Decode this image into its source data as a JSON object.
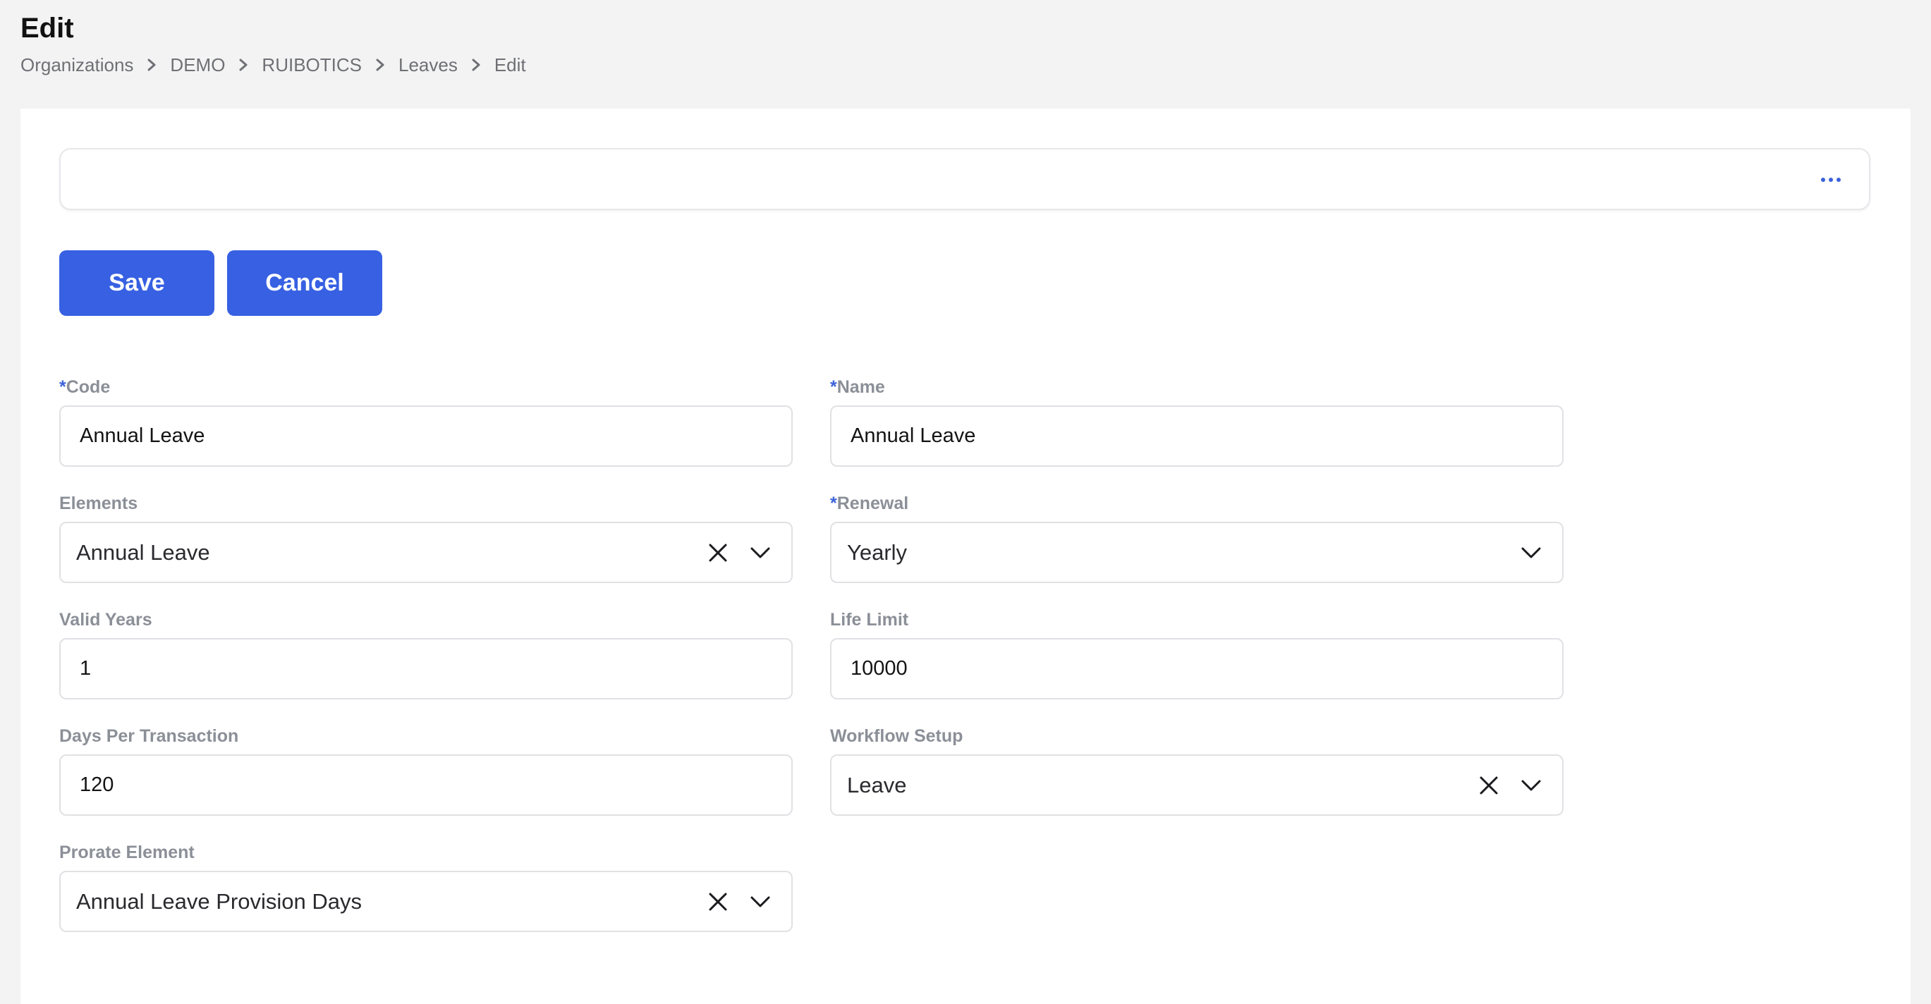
{
  "page": {
    "title": "Edit"
  },
  "breadcrumb": [
    "Organizations",
    "DEMO",
    "RUIBOTICS",
    "Leaves",
    "Edit"
  ],
  "toolbar": {
    "more_icon": "ellipsis-horizontal-icon",
    "save_label": "Save",
    "cancel_label": "Cancel"
  },
  "colors": {
    "primary": "#3760e2",
    "required_marker": "#3a62d9",
    "label": "#8b8f97",
    "page_background": "#f3f3f3"
  },
  "form": {
    "required_marker": "*",
    "code": {
      "label": "Code",
      "required": true,
      "value": "Annual Leave"
    },
    "name": {
      "label": "Name",
      "required": true,
      "value": "Annual Leave"
    },
    "elements": {
      "label": "Elements",
      "required": false,
      "value": "Annual Leave",
      "clearable": true
    },
    "renewal": {
      "label": "Renewal",
      "required": true,
      "value": "Yearly",
      "clearable": false
    },
    "valid_years": {
      "label": "Valid Years",
      "required": false,
      "value": "1"
    },
    "life_limit": {
      "label": "Life Limit",
      "required": false,
      "value": "10000"
    },
    "days_per_transaction": {
      "label": "Days Per Transaction",
      "required": false,
      "value": "120"
    },
    "workflow_setup": {
      "label": "Workflow Setup",
      "required": false,
      "value": "Leave",
      "clearable": true
    },
    "prorate_element": {
      "label": "Prorate Element",
      "required": false,
      "value": "Annual Leave Provision Days",
      "clearable": true
    }
  }
}
